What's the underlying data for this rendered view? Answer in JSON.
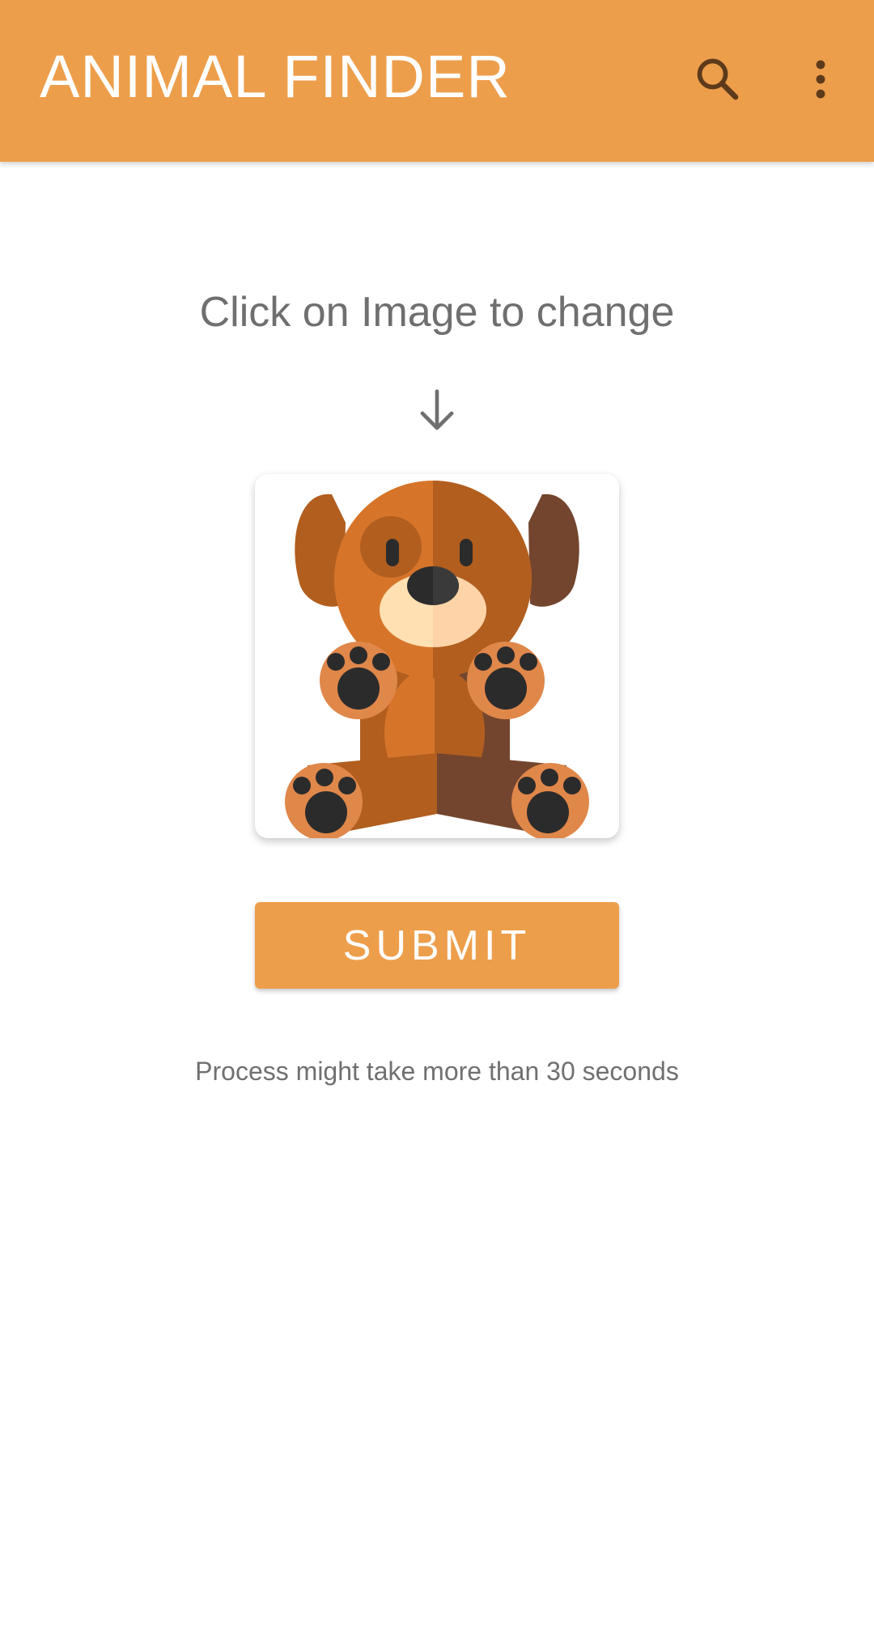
{
  "appbar": {
    "title": "ANIMAL FINDER",
    "search_icon": "search-icon",
    "more_icon": "more-vert-icon",
    "color": "#ED9E4B",
    "icon_color": "#5C3A1A"
  },
  "main": {
    "hint": "Click on Image to change",
    "arrow_icon": "arrow-down-icon",
    "image": "teddy-dog-illustration",
    "submit_label": "SUBMIT",
    "note": "Process might take more than 30 seconds"
  }
}
